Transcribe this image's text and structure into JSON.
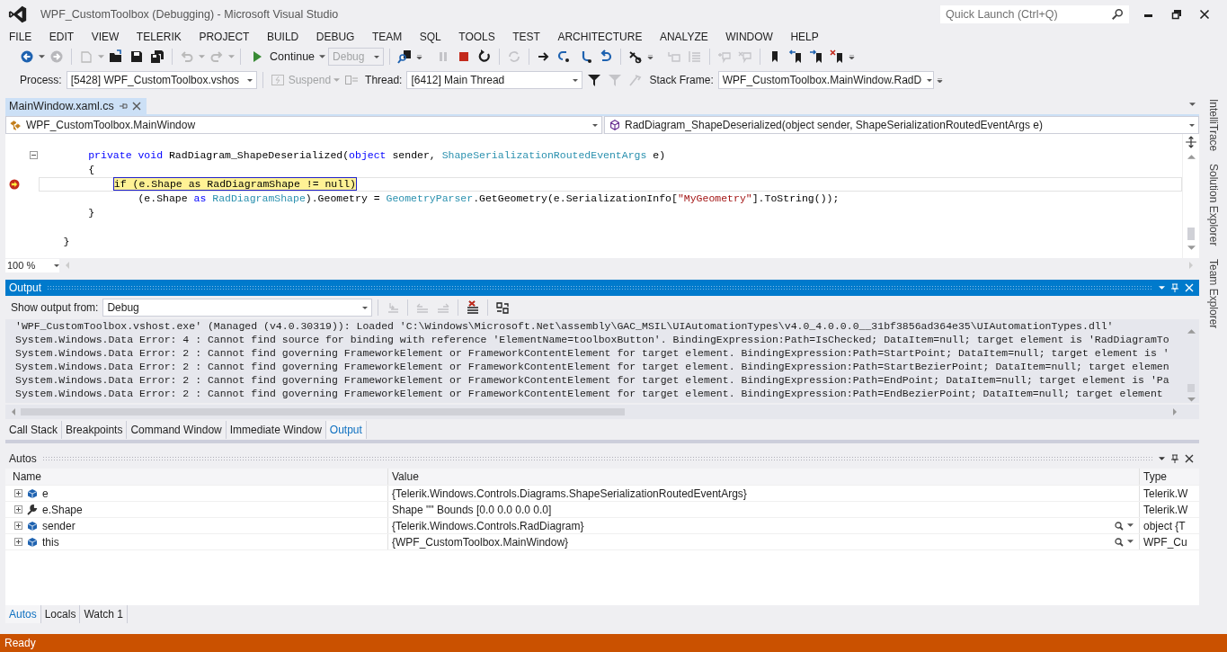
{
  "window": {
    "title": "WPF_CustomToolbox (Debugging) - Microsoft Visual Studio",
    "quick_launch": {
      "placeholder": "Quick Launch (Ctrl+Q)"
    }
  },
  "menu": [
    "FILE",
    "EDIT",
    "VIEW",
    "TELERIK",
    "PROJECT",
    "BUILD",
    "DEBUG",
    "TEAM",
    "SQL",
    "TOOLS",
    "TEST",
    "ARCHITECTURE",
    "ANALYZE",
    "WINDOW",
    "HELP"
  ],
  "toolbar": {
    "continue": "Continue",
    "configuration": {
      "value": "Debug",
      "disabled": true
    }
  },
  "debug_location": {
    "process_label": "Process:",
    "process": "[5428] WPF_CustomToolbox.vshos",
    "suspend": {
      "label": "Suspend",
      "disabled": true
    },
    "thread_label": "Thread:",
    "thread": "[6412] Main Thread",
    "stack_frame_label": "Stack Frame:",
    "stack_frame": "WPF_CustomToolbox.MainWindow.RadD"
  },
  "document_tabs": [
    {
      "label": "MainWindow.xaml.cs",
      "selected": true
    }
  ],
  "navigation": {
    "type": "WPF_CustomToolbox.MainWindow",
    "member": "RadDiagram_ShapeDeserialized(object sender, ShapeSerializationRoutedEventArgs e)"
  },
  "code_lines": [
    {
      "kind": "blank"
    },
    {
      "kind": "code",
      "collapsible": true,
      "current": false,
      "tokens": [
        {
          "kind": "keyword",
          "text": "        private"
        },
        {
          "kind": "keyword",
          "text": " void"
        },
        {
          "kind": "plain",
          "text": " RadDiagram_ShapeDeserialized("
        },
        {
          "kind": "keyword",
          "text": "object"
        },
        {
          "kind": "plain",
          "text": " sender, "
        },
        {
          "kind": "type",
          "text": "ShapeSerializationRoutedEventArgs"
        },
        {
          "kind": "plain",
          "text": " e)"
        }
      ]
    },
    {
      "kind": "code",
      "current": false,
      "tokens": [
        {
          "kind": "plain",
          "text": "        {"
        }
      ]
    },
    {
      "kind": "code",
      "breakpoint": true,
      "current": true,
      "tokens": [
        {
          "kind": "statement",
          "text": "            if (e.Shape as RadDiagramShape != null)"
        }
      ]
    },
    {
      "kind": "code",
      "current": false,
      "tokens": [
        {
          "kind": "plain",
          "text": "                (e.Shape "
        },
        {
          "kind": "keyword",
          "text": "as"
        },
        {
          "kind": "type",
          "text": " RadDiagramShape"
        },
        {
          "kind": "plain",
          "text": ").Geometry = "
        },
        {
          "kind": "type",
          "text": "GeometryParser"
        },
        {
          "kind": "plain",
          "text": ".GetGeometry(e.SerializationInfo["
        },
        {
          "kind": "string",
          "text": "\"MyGeometry\""
        },
        {
          "kind": "plain",
          "text": "].ToString());"
        }
      ]
    },
    {
      "kind": "code",
      "current": false,
      "tokens": [
        {
          "kind": "plain",
          "text": "        }"
        }
      ]
    },
    {
      "kind": "blank"
    },
    {
      "kind": "code",
      "current": false,
      "tokens": [
        {
          "kind": "plain",
          "text": "    }"
        }
      ]
    }
  ],
  "zoom": "100 %",
  "output": {
    "title": "Output",
    "show_from_label": "Show output from:",
    "source": "Debug",
    "lines": [
      "'WPF_CustomToolbox.vshost.exe' (Managed (v4.0.30319)): Loaded 'C:\\Windows\\Microsoft.Net\\assembly\\GAC_MSIL\\UIAutomationTypes\\v4.0_4.0.0.0__31bf3856ad364e35\\UIAutomationTypes.dll'",
      "System.Windows.Data Error: 4 : Cannot find source for binding with reference 'ElementName=toolboxButton'. BindingExpression:Path=IsChecked; DataItem=null; target element is 'RadDiagramTo",
      "System.Windows.Data Error: 2 : Cannot find governing FrameworkElement or FrameworkContentElement for target element. BindingExpression:Path=StartPoint; DataItem=null; target element is '",
      "System.Windows.Data Error: 2 : Cannot find governing FrameworkElement or FrameworkContentElement for target element. BindingExpression:Path=StartBezierPoint; DataItem=null; target elemen",
      "System.Windows.Data Error: 2 : Cannot find governing FrameworkElement or FrameworkContentElement for target element. BindingExpression:Path=EndPoint; DataItem=null; target element is 'Pa",
      "System.Windows.Data Error: 2 : Cannot find governing FrameworkElement or FrameworkContentElement for target element. BindingExpression:Path=EndBezierPoint; DataItem=null; target element"
    ]
  },
  "middle_tabs": [
    {
      "label": "Call Stack",
      "selected": false
    },
    {
      "label": "Breakpoints",
      "selected": false
    },
    {
      "label": "Command Window",
      "selected": false
    },
    {
      "label": "Immediate Window",
      "selected": false
    },
    {
      "label": "Output",
      "selected": true
    }
  ],
  "autos": {
    "title": "Autos",
    "columns": [
      "Name",
      "Value",
      "Type"
    ],
    "rows": [
      {
        "kind": "variable",
        "name": "e",
        "value": "{Telerik.Windows.Controls.Diagrams.ShapeSerializationRoutedEventArgs}",
        "type": "Telerik.W",
        "visualizer": false
      },
      {
        "kind": "property",
        "name": "e.Shape",
        "value": "Shape \"\" Bounds [0.0 0.0 0.0 0.0]",
        "type": "Telerik.W",
        "visualizer": false
      },
      {
        "kind": "variable",
        "name": "sender",
        "value": "{Telerik.Windows.Controls.RadDiagram}",
        "type": "object {T",
        "visualizer": true
      },
      {
        "kind": "variable",
        "name": "this",
        "value": "{WPF_CustomToolbox.MainWindow}",
        "type": "WPF_Cu",
        "visualizer": true
      }
    ]
  },
  "bottom_tabs": [
    {
      "label": "Autos",
      "selected": true
    },
    {
      "label": "Locals",
      "selected": false
    },
    {
      "label": "Watch 1",
      "selected": false
    }
  ],
  "side_tabs": [
    "IntelliTrace",
    "Solution Explorer",
    "Team Explorer"
  ],
  "status_bar": "Ready"
}
